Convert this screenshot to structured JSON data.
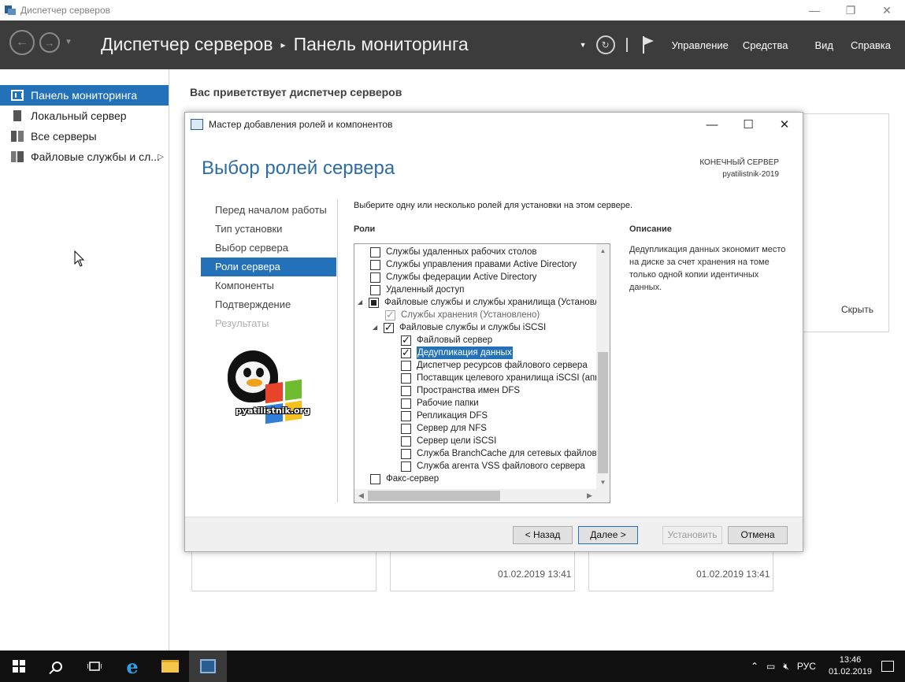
{
  "window": {
    "title": "Диспетчер серверов",
    "controls": {
      "minimize": "—",
      "restore": "❐",
      "close": "✕"
    }
  },
  "header": {
    "breadcrumb_app": "Диспетчер серверов",
    "breadcrumb_sep": "▸",
    "breadcrumb_page": "Панель мониторинга",
    "menus": [
      "Управление",
      "Средства",
      "Вид",
      "Справка"
    ]
  },
  "sidebar": {
    "items": [
      {
        "label": "Панель мониторинга",
        "icon": "dashboard-icon",
        "active": true
      },
      {
        "label": "Локальный сервер",
        "icon": "server-icon",
        "active": false
      },
      {
        "label": "Все серверы",
        "icon": "servers-icon",
        "active": false
      },
      {
        "label": "Файловые службы и сл...",
        "icon": "file-services-icon",
        "active": false
      }
    ]
  },
  "main": {
    "welcome": "Вас приветствует диспетчер серверов",
    "hide_link": "Скрыть",
    "tile_dates": [
      "01.02.2019 13:41",
      "01.02.2019 13:41"
    ]
  },
  "dialog": {
    "title": "Мастер добавления ролей и компонентов",
    "heading": "Выбор ролей сервера",
    "dest_label": "КОНЕЧНЫЙ СЕРВЕР",
    "dest_server": "pyatilistnik-2019",
    "steps": [
      {
        "label": "Перед началом работы",
        "state": "normal"
      },
      {
        "label": "Тип установки",
        "state": "normal"
      },
      {
        "label": "Выбор сервера",
        "state": "normal"
      },
      {
        "label": "Роли сервера",
        "state": "active"
      },
      {
        "label": "Компоненты",
        "state": "normal"
      },
      {
        "label": "Подтверждение",
        "state": "normal"
      },
      {
        "label": "Результаты",
        "state": "disabled"
      }
    ],
    "logo_text": "pyatilistnik.org",
    "instruction": "Выберите одну или несколько ролей для установки на этом сервере.",
    "roles_label": "Роли",
    "desc_label": "Описание",
    "desc_text": "Дедупликация данных экономит место на диске за счет хранения на томе только одной копии идентичных данных.",
    "roles": [
      {
        "label": "Службы удаленных рабочих столов",
        "level": 0,
        "state": "unchecked"
      },
      {
        "label": "Службы управления правами Active Directory",
        "level": 0,
        "state": "unchecked"
      },
      {
        "label": "Службы федерации Active Directory",
        "level": 0,
        "state": "unchecked"
      },
      {
        "label": "Удаленный доступ",
        "level": 0,
        "state": "unchecked"
      },
      {
        "label": "Файловые службы и службы хранилища (Установлено)",
        "level": 0,
        "state": "partial",
        "expander": "◢"
      },
      {
        "label": "Службы хранения (Установлено)",
        "level": 1,
        "state": "installed"
      },
      {
        "label": "Файловые службы и службы iSCSI",
        "level": 1,
        "state": "checked",
        "expander": "◢"
      },
      {
        "label": "Файловый сервер",
        "level": 2,
        "state": "checked"
      },
      {
        "label": "Дедупликация данных",
        "level": 2,
        "state": "checked",
        "selected": true
      },
      {
        "label": "Диспетчер ресурсов файлового сервера",
        "level": 2,
        "state": "unchecked"
      },
      {
        "label": "Поставщик целевого хранилища iSCSI (аппаратные поставщики VDS и VSS)",
        "level": 2,
        "state": "unchecked"
      },
      {
        "label": "Пространства имен DFS",
        "level": 2,
        "state": "unchecked"
      },
      {
        "label": "Рабочие папки",
        "level": 2,
        "state": "unchecked"
      },
      {
        "label": "Репликация DFS",
        "level": 2,
        "state": "unchecked"
      },
      {
        "label": "Сервер для NFS",
        "level": 2,
        "state": "unchecked"
      },
      {
        "label": "Сервер цели iSCSI",
        "level": 2,
        "state": "unchecked"
      },
      {
        "label": "Служба BranchCache для сетевых файлов",
        "level": 2,
        "state": "unchecked"
      },
      {
        "label": "Служба агента VSS файлового сервера",
        "level": 2,
        "state": "unchecked"
      },
      {
        "label": "Факс-сервер",
        "level": 0,
        "state": "unchecked"
      }
    ],
    "buttons": {
      "back": "< Назад",
      "next": "Далее >",
      "install": "Установить",
      "cancel": "Отмена"
    }
  },
  "taskbar": {
    "lang": "РУС",
    "time": "13:46",
    "date": "01.02.2019"
  },
  "colors": {
    "accent": "#2372b9",
    "header_bg": "#3c3c3c",
    "heading_blue": "#2d6ca5"
  }
}
